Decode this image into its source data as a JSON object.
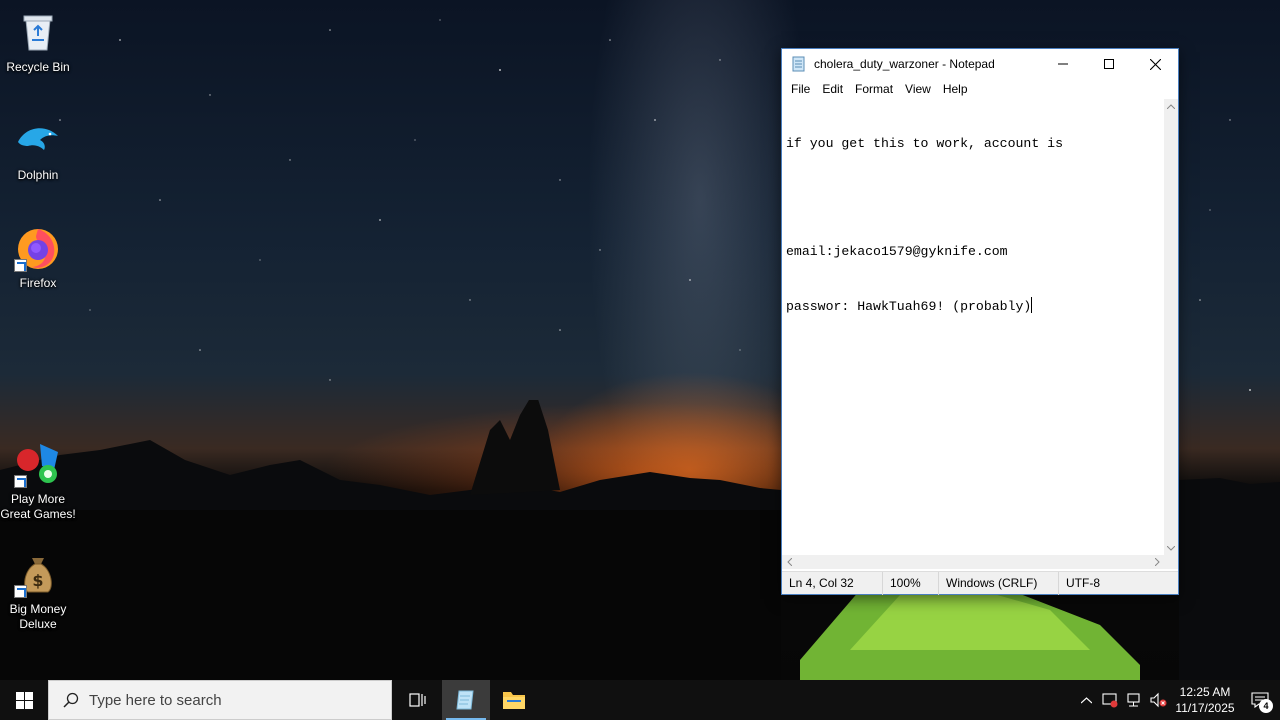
{
  "desktop": {
    "icons": [
      {
        "label": "Recycle Bin"
      },
      {
        "label": "Dolphin"
      },
      {
        "label": "Firefox"
      },
      {
        "label": "Play More Great Games!"
      },
      {
        "label": "Big Money Deluxe"
      }
    ]
  },
  "notepad": {
    "title": "cholera_duty_warzoner - Notepad",
    "menu": [
      "File",
      "Edit",
      "Format",
      "View",
      "Help"
    ],
    "lines": [
      "if you get this to work, account is",
      "",
      "email:jekaco1579@gyknife.com",
      "passwor: HawkTuah69! (probably)"
    ],
    "status": {
      "position": "Ln 4, Col 32",
      "zoom": "100%",
      "line_ending": "Windows (CRLF)",
      "encoding": "UTF-8"
    }
  },
  "taskbar": {
    "search_placeholder": "Type here to search",
    "time": "12:25 AM",
    "date": "11/17/2025",
    "notification_count": "4"
  },
  "colors": {
    "taskbar": "#101010",
    "window_border": "#4a7fc0",
    "accent": "#76b9ed"
  }
}
